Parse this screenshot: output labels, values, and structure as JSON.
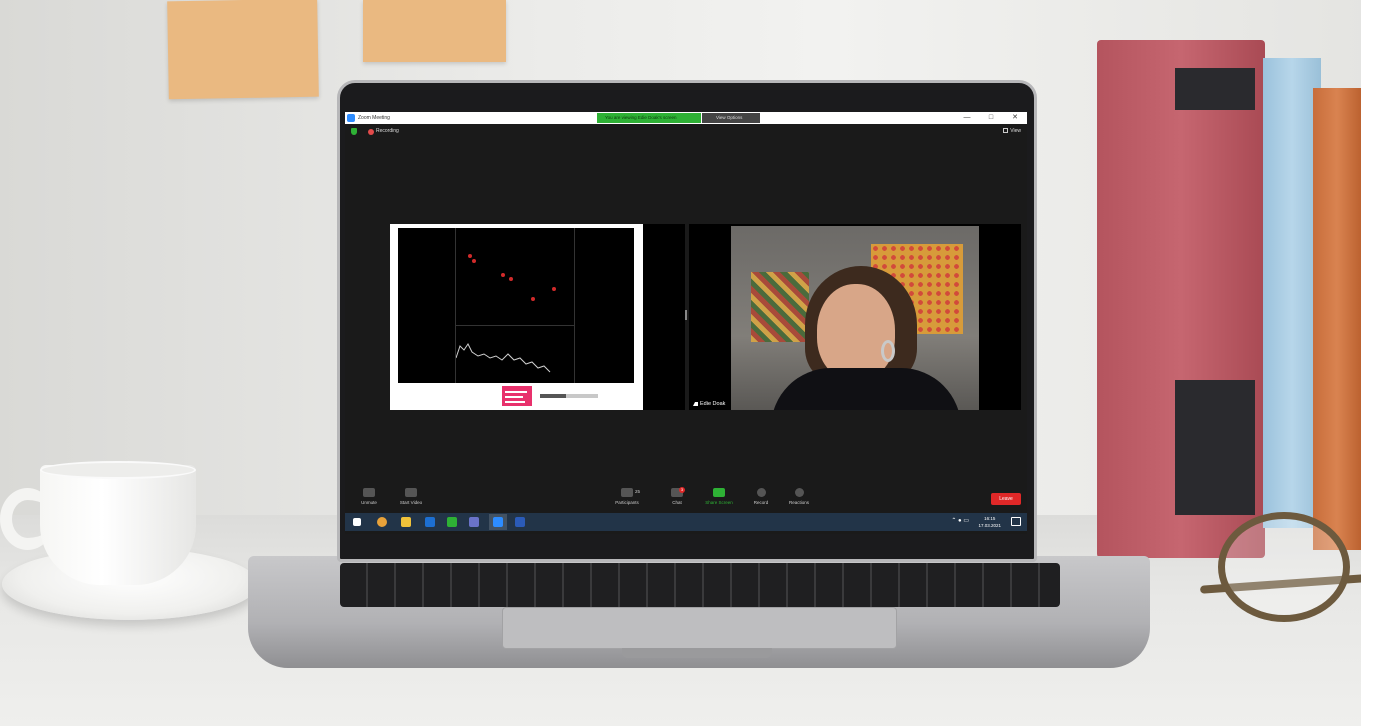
{
  "window": {
    "title": "Zoom Meeting",
    "share_banner": "You are viewing Edie Doak's screen",
    "view_options": "View Options",
    "minimize": "—",
    "maximize": "□",
    "close": "✕"
  },
  "meeting_info": {
    "recording_label": "Recording",
    "view_label": "View"
  },
  "video": {
    "participant_name": "Edie Doak"
  },
  "shared_content": {
    "logo_text": "Shock Awards",
    "progress_fraction": 0.45
  },
  "toolbar": {
    "unmute": "Unmute",
    "start_video": "Start Video",
    "participants": "Participants",
    "participants_count": "25",
    "chat": "Chat",
    "chat_badge": "3",
    "share_screen": "Share Screen",
    "record": "Record",
    "reactions": "Reactions",
    "leave": "Leave"
  },
  "taskbar": {
    "time": "16:15",
    "date": "17.03.2021"
  },
  "colors": {
    "zoom_blue": "#2d8cff",
    "zoom_green": "#2eb135",
    "leave_red": "#e02828",
    "recording_red": "#e34b4b"
  },
  "icons": [
    "windows-start-icon",
    "chrome-icon",
    "file-explorer-icon",
    "outlook-icon",
    "evernote-icon",
    "teams-icon",
    "zoom-icon",
    "word-icon"
  ]
}
